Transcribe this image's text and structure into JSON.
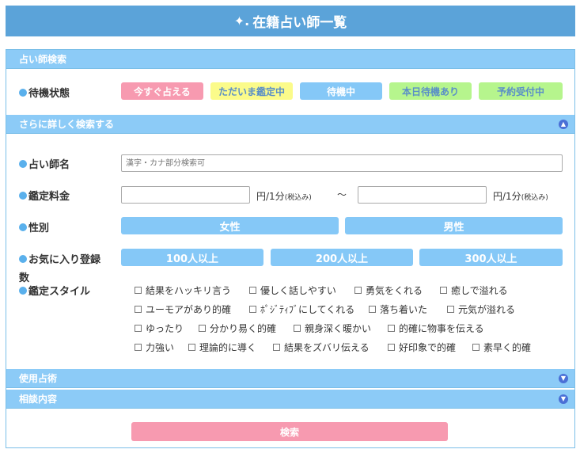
{
  "title": "在籍占い師一覧",
  "sections": {
    "search": "占い師検索",
    "detail": "さらに詳しく検索する",
    "divination": "使用占術",
    "consult": "相談内容"
  },
  "status": {
    "label": "待機状態",
    "options": [
      "今すぐ占える",
      "ただいま鑑定中",
      "待機中",
      "本日待機あり",
      "予約受付中"
    ]
  },
  "name": {
    "label": "占い師名",
    "placeholder": "漢字・カナ部分検索可"
  },
  "fee": {
    "label": "鑑定料金",
    "unit": "円/1分",
    "tax": "(税込み)",
    "sep": "〜"
  },
  "gender": {
    "label": "性別",
    "options": [
      "女性",
      "男性"
    ]
  },
  "favorite": {
    "label_line1": "お気に入り登録",
    "label_line2": "数",
    "options": [
      "100人以上",
      "200人以上",
      "300人以上"
    ]
  },
  "style": {
    "label": "鑑定スタイル",
    "rows": [
      [
        "結果をハッキリ言う",
        "優しく話しやすい",
        "勇気をくれる",
        "癒しで溢れる"
      ],
      [
        "ユーモアがあり的確",
        "ﾎﾟｼﾞﾃｨﾌﾞにしてくれる",
        "落ち着いた",
        "元気が溢れる"
      ],
      [
        "ゆったり",
        "分かり易く的確",
        "親身深く暖かい",
        "的確に物事を伝える"
      ],
      [
        "力強い",
        "理論的に導く",
        "結果をズバリ伝える",
        "好印象で的確",
        "素早く的確"
      ]
    ]
  },
  "search_button": "検索",
  "colors": {
    "header": "#5ba3d9",
    "bar": "#8ccbf7",
    "pink": "#f79ab0",
    "yellow": "#fbfb8a",
    "green": "#b6f58d"
  }
}
